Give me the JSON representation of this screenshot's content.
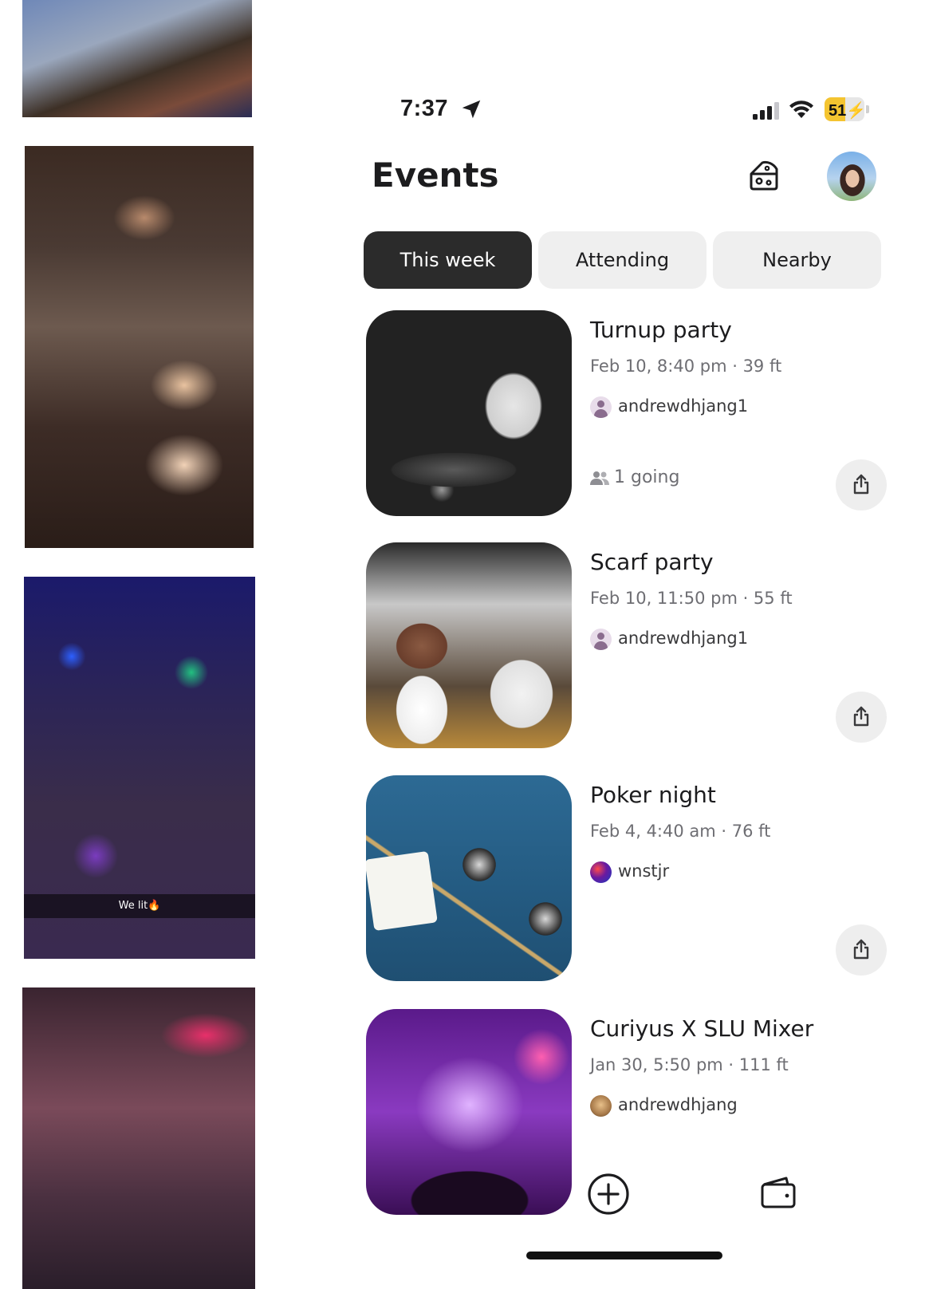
{
  "photo_strip": {
    "snap_caption": "We lit🔥"
  },
  "status_bar": {
    "time": "7:37",
    "battery": "51",
    "battery_fraction": 0.51,
    "battery_charging": true
  },
  "header": {
    "title": "Events"
  },
  "tabs": [
    {
      "label": "This week",
      "active": true
    },
    {
      "label": "Attending",
      "active": false
    },
    {
      "label": "Nearby",
      "active": false
    }
  ],
  "events": [
    {
      "title": "Turnup party",
      "meta": "Feb 10, 8:40 pm · 39 ft",
      "host": "andrewdhjang1",
      "going": "1 going"
    },
    {
      "title": "Scarf party",
      "meta": "Feb 10, 11:50 pm · 55 ft",
      "host": "andrewdhjang1"
    },
    {
      "title": "Poker night",
      "meta": "Feb 4, 4:40 am · 76 ft",
      "host": "wnstjr"
    },
    {
      "title": "Curiyus X SLU Mixer",
      "meta": "Jan 30, 5:50 pm · 111 ft",
      "host": "andrewdhjang"
    }
  ],
  "colors": {
    "active_tab": "#2b2b2b",
    "inactive_tab": "#efefef",
    "battery_fill": "#f4c430",
    "share_button_bg": "#eeeeee"
  },
  "icons": {
    "location": "location-arrow-icon",
    "signal": "cellular-signal-icon",
    "wifi": "wifi-icon",
    "cheese": "cheese-icon",
    "share": "share-icon",
    "people": "people-icon",
    "add": "plus-circle-icon",
    "wallet": "wallet-icon"
  }
}
